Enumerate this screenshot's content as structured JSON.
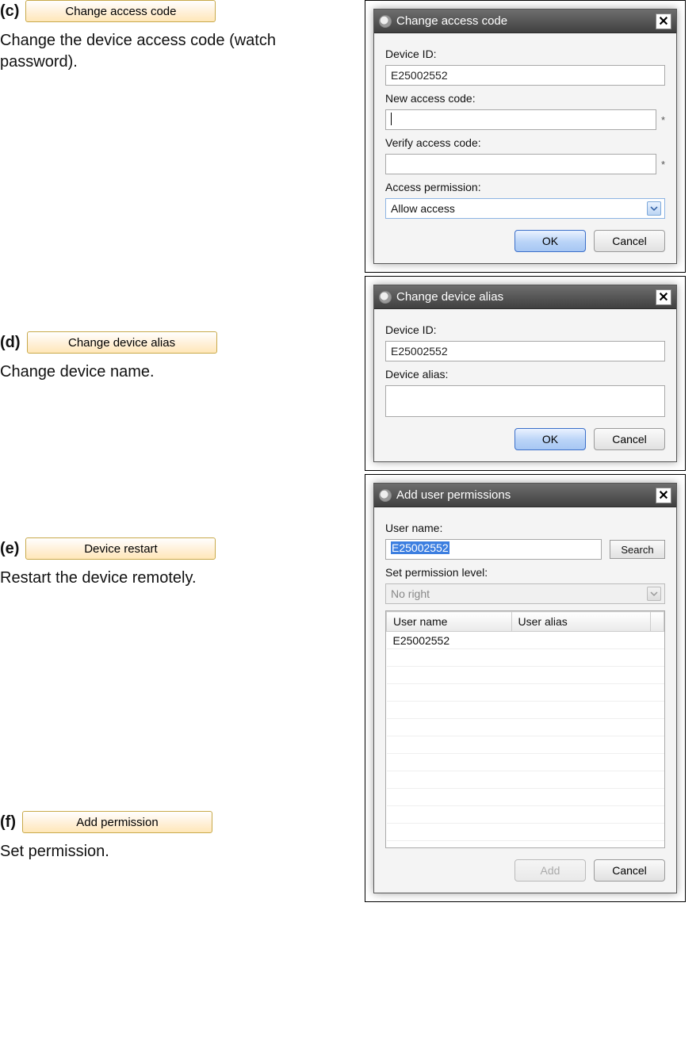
{
  "items": {
    "c": {
      "marker": "(c)",
      "button": "Change access code",
      "desc": "Change the device access code (watch password)."
    },
    "d": {
      "marker": "(d)",
      "button": "Change device alias",
      "desc": "Change device name."
    },
    "e": {
      "marker": "(e)",
      "button": "Device restart",
      "desc": "Restart the device remotely."
    },
    "f": {
      "marker": "(f)",
      "button": "Add permission",
      "desc": "Set permission."
    }
  },
  "dialog_c": {
    "title": "Change access code",
    "device_id_label": "Device ID:",
    "device_id_value": "E25002552",
    "new_code_label": "New access code:",
    "new_code_value": "",
    "verify_label": "Verify access code:",
    "verify_value": "",
    "access_perm_label": "Access permission:",
    "access_perm_value": "Allow access",
    "ok": "OK",
    "cancel": "Cancel",
    "asterisk": "*"
  },
  "dialog_d": {
    "title": "Change device alias",
    "device_id_label": "Device ID:",
    "device_id_value": "E25002552",
    "alias_label": "Device alias:",
    "alias_value": "",
    "ok": "OK",
    "cancel": "Cancel"
  },
  "dialog_f": {
    "title": "Add user permissions",
    "username_label": "User name:",
    "username_value": "E25002552",
    "search": "Search",
    "perm_level_label": "Set permission level:",
    "perm_level_value": "No right",
    "table_headers": [
      "User name",
      "User alias"
    ],
    "table_rows": [
      [
        "E25002552",
        ""
      ]
    ],
    "add": "Add",
    "cancel": "Cancel"
  },
  "close_glyph": "✕"
}
